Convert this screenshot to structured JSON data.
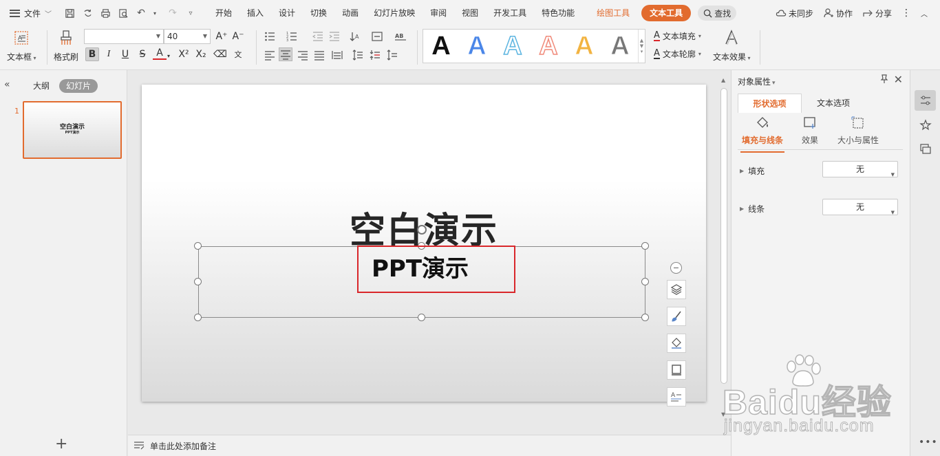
{
  "menubar": {
    "file_label": "文件",
    "tabs": [
      "开始",
      "插入",
      "设计",
      "切换",
      "动画",
      "幻灯片放映",
      "审阅",
      "视图",
      "开发工具",
      "特色功能"
    ],
    "drawing_tools": "绘图工具",
    "text_tools": "文本工具",
    "search": "查找",
    "sync": "未同步",
    "collab": "协作",
    "share": "分享"
  },
  "ribbon": {
    "textbox_label": "文本框",
    "format_painter_label": "格式刷",
    "font_name": "",
    "font_size": "40",
    "text_fill": "文本填充",
    "text_outline": "文本轮廓",
    "text_effect": "文本效果",
    "wordart_styles": [
      {
        "letter": "A",
        "color": "#111111"
      },
      {
        "letter": "A",
        "color": "#4a86e8"
      },
      {
        "letter": "A",
        "color": "#5bb4e0"
      },
      {
        "letter": "A",
        "color": "#f08a7a"
      },
      {
        "letter": "A",
        "color": "#f2b340"
      },
      {
        "letter": "A",
        "color": "#777777"
      }
    ]
  },
  "leftpanel": {
    "tab_outline": "大纲",
    "tab_slides": "幻灯片",
    "slide_number": "1",
    "thumb_title": "空白演示",
    "thumb_subtitle": "PPT演示"
  },
  "slide": {
    "title": "空白演示",
    "subtitle": "PPT演示"
  },
  "notes": {
    "placeholder": "单击此处添加备注"
  },
  "props": {
    "title": "对象属性",
    "tab_shape": "形状选项",
    "tab_text": "文本选项",
    "sub_fill_line": "填充与线条",
    "sub_effect": "效果",
    "sub_size": "大小与属性",
    "fill_label": "填充",
    "fill_value": "无",
    "line_label": "线条",
    "line_value": "无"
  },
  "watermark": {
    "main": "Baidu经验",
    "sub": "jingyan.baidu.com"
  },
  "colors": {
    "accent": "#e26b2e",
    "selection_box": "#d9262a"
  }
}
